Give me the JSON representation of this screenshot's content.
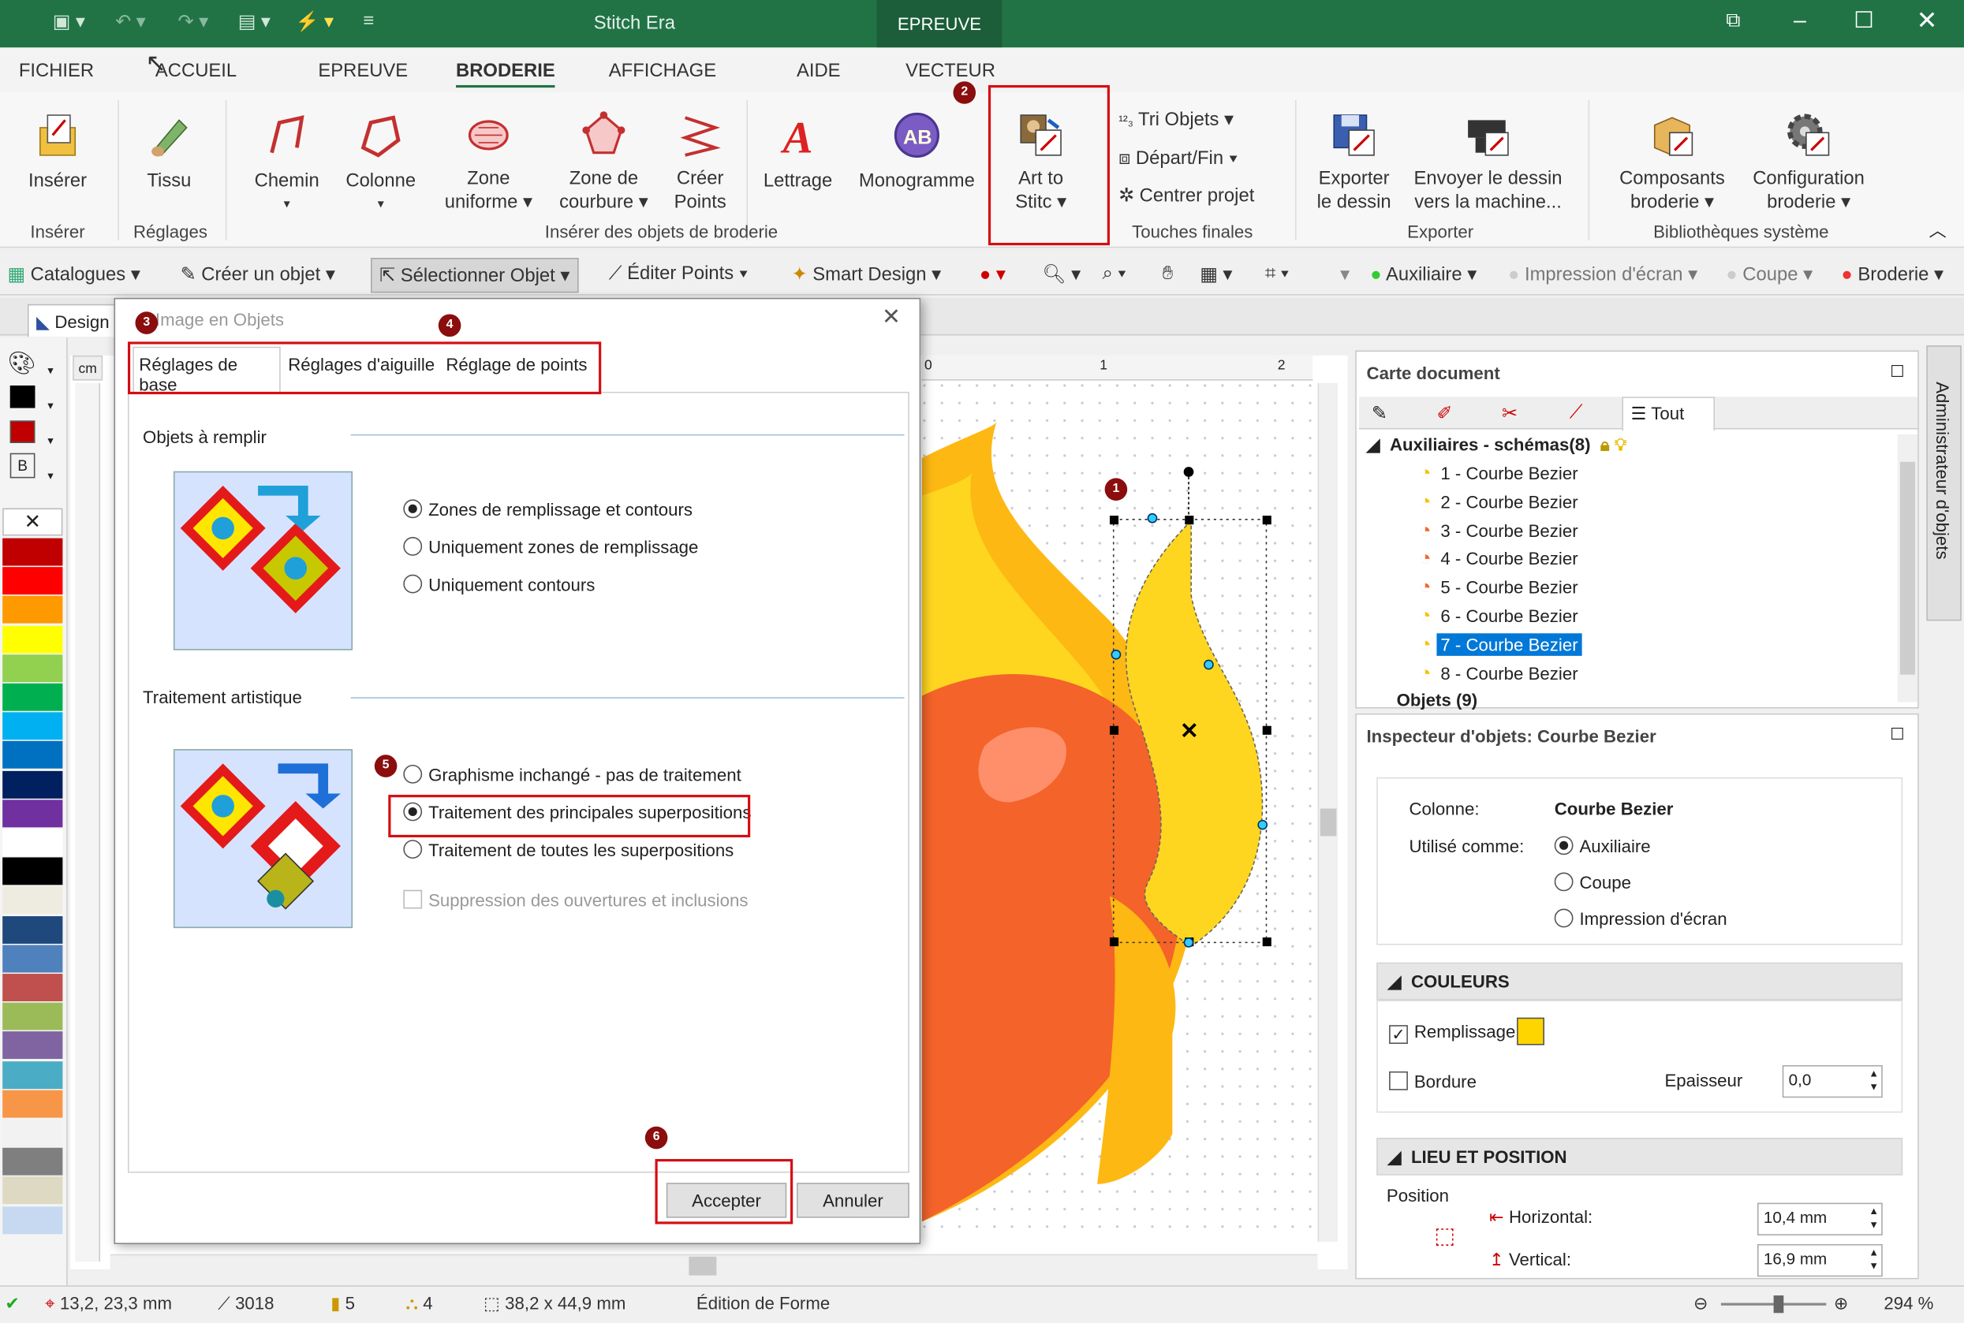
{
  "app": {
    "title": "Stitch Era",
    "context_tab": "EPREUVE"
  },
  "menu_tabs": [
    "FICHIER",
    "ACCUEIL",
    "EPREUVE",
    "BRODERIE",
    "AFFICHAGE",
    "AIDE",
    "VECTEUR"
  ],
  "ribbon": {
    "buttons": {
      "inserer": "Insérer",
      "tissu": "Tissu",
      "chemin": "Chemin",
      "colonne": "Colonne",
      "zone_uniforme_1": "Zone",
      "zone_uniforme_2": "uniforme",
      "zone_courbure_1": "Zone de",
      "zone_courbure_2": "courbure",
      "creer_points_1": "Créer",
      "creer_points_2": "Points",
      "lettrage": "Lettrage",
      "monogramme": "Monogramme",
      "art_1": "Art to",
      "art_2": "Stitc",
      "tri_objets": "Tri  Objets",
      "depart_fin": "Départ/Fin",
      "centrer": "Centrer projet",
      "exporter_1": "Exporter",
      "exporter_2": "le dessin",
      "envoyer_1": "Envoyer le dessin",
      "envoyer_2": "vers la machine...",
      "composants_1": "Composants",
      "composants_2": "broderie",
      "config_1": "Configuration",
      "config_2": "broderie"
    },
    "groups": {
      "inserer": "Insérer",
      "reglages": "Réglages",
      "inserer_objets": "Insérer des objets de broderie",
      "touches": "Touches finales",
      "exporter": "Exporter",
      "biblio": "Bibliothèques système"
    }
  },
  "toolbar": {
    "catalogues": "Catalogues",
    "creer_objet": "Créer un objet",
    "selectionner": "Sélectionner Objet",
    "editer": "Éditer Points",
    "smart": "Smart Design",
    "auxiliaire": "Auxiliaire",
    "impression": "Impression d'écran",
    "coupe": "Coupe",
    "broderie": "Broderie"
  },
  "doc_tab": "Design",
  "ruler_unit": "cm",
  "dialog": {
    "title": "Image en Objets",
    "tabs": [
      "Réglages de base",
      "Réglages d'aiguille",
      "Réglage de points"
    ],
    "section1": "Objets à remplir",
    "fill_options": [
      "Zones de remplissage et contours",
      "Uniquement zones de remplissage",
      "Uniquement contours"
    ],
    "section2": "Traitement artistique",
    "art_options": [
      "Graphisme inchangé - pas de traitement",
      "Traitement des principales superpositions",
      "Traitement de toutes les superpositions"
    ],
    "checkbox": "Suppression des ouvertures et inclusions",
    "accept": "Accepter",
    "cancel": "Annuler"
  },
  "badges": [
    "1",
    "2",
    "3",
    "4",
    "5",
    "6"
  ],
  "ruler_top": [
    "0",
    "1",
    "2"
  ],
  "doc_map": {
    "title": "Carte document",
    "tab_all": "Tout",
    "group1": "Auxiliaires - schémas(8)",
    "items": [
      "1 - Courbe Bezier",
      "2 - Courbe Bezier",
      "3 - Courbe Bezier",
      "4 - Courbe Bezier",
      "5 - Courbe Bezier",
      "6 - Courbe Bezier",
      "7 - Courbe Bezier",
      "8 - Courbe Bezier"
    ],
    "item_colors": [
      "#f5c400",
      "#f5c400",
      "#f26a2c",
      "#f26a2c",
      "#f26a2c",
      "#f5c400",
      "#f5c400",
      "#f5c400"
    ],
    "group2": "Objets (9)"
  },
  "side_tab": "Administrateur d'objets",
  "inspector": {
    "title": "Inspecteur d'objets: Courbe Bezier",
    "colonne_label": "Colonne:",
    "colonne_value": "Courbe Bezier",
    "used_label": "Utilisé comme:",
    "used_options": [
      "Auxiliaire",
      "Coupe",
      "Impression d'écran"
    ],
    "colors_header": "COULEURS",
    "fill_label": "Remplissage",
    "fill_color": "#ffd500",
    "border_label": "Bordure",
    "thickness_label": "Epaisseur",
    "thickness_value": "0,0",
    "position_header": "LIEU ET POSITION",
    "position_label": "Position",
    "horizontal_label": "Horizontal:",
    "horizontal_value": "10,4 mm",
    "vertical_label": "Vertical:",
    "vertical_value": "16,9 mm"
  },
  "palette": [
    "#c00000",
    "#ff0000",
    "#ff9900",
    "#ffff00",
    "#92d050",
    "#00b050",
    "#00b0f0",
    "#0070c0",
    "#002060",
    "#7030a0",
    "#ffffff",
    "#000000",
    "#eeece1",
    "#1f497d",
    "#4f81bd",
    "#c0504d",
    "#9bbb59",
    "#8064a2",
    "#4bacc6",
    "#f79646",
    "#f2f2f2",
    "#7f7f7f",
    "#ddd9c3",
    "#c6d9f0"
  ],
  "status": {
    "coords": "13,2, 23,3 mm",
    "stitches": "3018",
    "colors": "5",
    "objects": "4",
    "size": "38,2 x 44,9 mm",
    "mode": "Édition de Forme",
    "zoom": "294 %"
  }
}
